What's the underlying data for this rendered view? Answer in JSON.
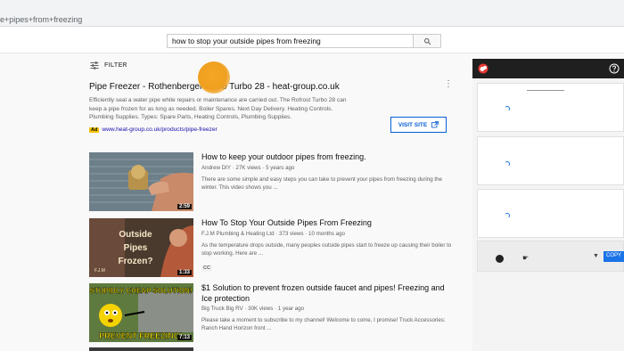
{
  "browser": {
    "url_text": "e+pipes+from+freezing"
  },
  "search": {
    "value": "how to stop your outside pipes from freezing"
  },
  "filter": {
    "label": "FILTER"
  },
  "ad": {
    "title": "Pipe Freezer - Rothenberger Rofro Turbo 28 - heat-group.co.uk",
    "description": "Efficiently seal a water pipe while repairs or maintenance are carried out. The Rofrost Turbo 28 can keep a pipe frozen for as long as needed. Boiler Spares. Next Day Delivery. Heating Controls. Plumbing Supplies. Types: Spare Parts, Heating Controls, Plumbing Supplies.",
    "badge": "Ad",
    "url": "www.heat-group.co.uk/products/pipe-freezer",
    "visit_label": "VISIT SITE"
  },
  "videos": [
    {
      "title": "How to keep your outdoor pipes from freezing.",
      "meta": "Andrew DIY · 27K views · 5 years ago",
      "desc": "There are some simple and easy steps you can take to prevent your pipes from freezing during the winter. This video shows you ...",
      "duration": "2:59"
    },
    {
      "title": "How To Stop Your Outside Pipes From Freezing",
      "meta": "F.J.M Plumbing & Heating Ltd · 373 views · 10 months ago",
      "desc": "As the temperature drops outside, many peoples outside pipes start to freeze up causing their boiler to stop working. Here are ...",
      "cc": "CC",
      "duration": "1:33",
      "thumb_text": "Outside Pipes Frozen?",
      "thumb_brand": "F.J.M"
    },
    {
      "title": "$1 Solution to prevent frozen outside faucet and pipes! Freezing and Ice protection",
      "meta": "Big Truck Big RV · 30K views · 1 year ago",
      "desc": "Please take a moment to subscribe to my channel! Welcome to come, I promise! Truck Accessories: Ranch Hand Horizon front ...",
      "duration": "7:13",
      "thumb_top": "STUPIDLY CHEAP SOLUTION!",
      "thumb_bottom": "PREVENT FREEZING!"
    }
  ],
  "sidebar": {
    "copy_label": "COPY"
  }
}
